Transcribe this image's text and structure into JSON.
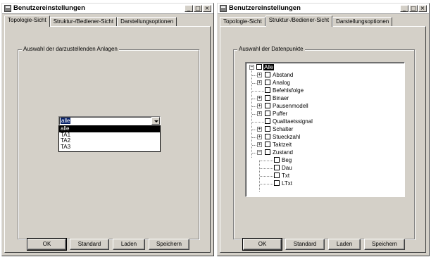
{
  "left_window": {
    "title": "Benutzereinstellungen",
    "tabs": [
      "Topologie-Sicht",
      "Struktur-/Bediener-Sicht",
      "Darstellungsoptionen"
    ],
    "active_tab": 0,
    "group_title": "Auswahl der darzustellenden Anlagen",
    "combo": {
      "value": "alle",
      "options": [
        "alle",
        "TA1",
        "TA2",
        "TA3"
      ],
      "selected_index": 0
    },
    "buttons": {
      "ok": "OK",
      "standard": "Standard",
      "laden": "Laden",
      "speichern": "Speichern"
    }
  },
  "right_window": {
    "title": "Benutzereinstellungen",
    "tabs": [
      "Topologie-Sicht",
      "Struktur-/Bediener-Sicht",
      "Darstellungsoptionen"
    ],
    "active_tab": 1,
    "group_title": "Auswahl der Datenpunkte",
    "tree": {
      "root": "Alle",
      "items": [
        {
          "label": "Abstand",
          "expander": "+"
        },
        {
          "label": "Analog",
          "expander": "+"
        },
        {
          "label": "Befehlsfolge",
          "expander": ""
        },
        {
          "label": "Binaer",
          "expander": "+"
        },
        {
          "label": "Pausenmodell",
          "expander": "+"
        },
        {
          "label": "Puffer",
          "expander": "+"
        },
        {
          "label": "Qualitaetssignal",
          "expander": ""
        },
        {
          "label": "Schalter",
          "expander": "+"
        },
        {
          "label": "Stueckzahl",
          "expander": "+"
        },
        {
          "label": "Taktzeit",
          "expander": "+"
        },
        {
          "label": "Zustand",
          "expander": "−"
        }
      ],
      "zustand_children": [
        "Beg",
        "Dau",
        "Txt",
        "LTxt"
      ]
    },
    "buttons": {
      "ok": "OK",
      "standard": "Standard",
      "laden": "Laden",
      "speichern": "Speichern"
    }
  },
  "titlebar_buttons": {
    "minimize": "_",
    "maximize": "□",
    "close": "×"
  },
  "colors": {
    "window_face": "#d4d0c8",
    "selection": "#0a246a",
    "tree_selection": "#000000"
  }
}
